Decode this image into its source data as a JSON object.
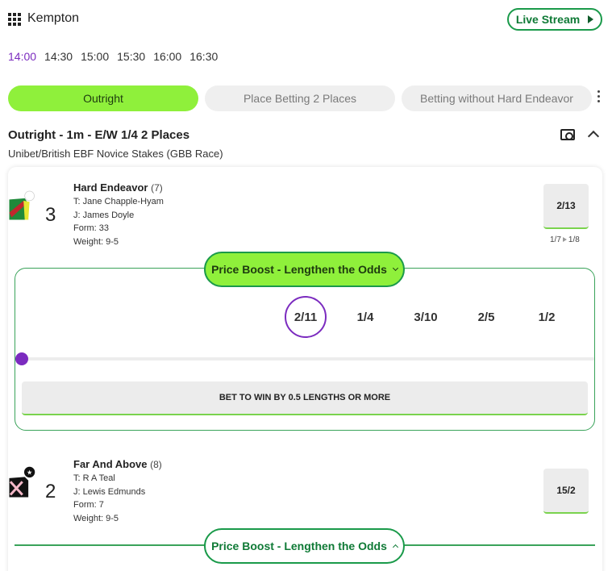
{
  "header": {
    "venue": "Kempton",
    "live_stream_label": "Live Stream"
  },
  "race_times": [
    {
      "label": "14:00",
      "active": true
    },
    {
      "label": "14:30",
      "active": false
    },
    {
      "label": "15:00",
      "active": false
    },
    {
      "label": "15:30",
      "active": false
    },
    {
      "label": "16:00",
      "active": false
    },
    {
      "label": "16:30",
      "active": false
    }
  ],
  "bet_tabs": [
    {
      "label": "Outright",
      "active": true
    },
    {
      "label": "Place Betting 2 Places",
      "active": false
    },
    {
      "label": "Betting without Hard Endeavor",
      "active": false
    }
  ],
  "market": {
    "title": "Outright - 1m - E/W 1/4 2 Places",
    "subtitle": "Unibet/British EBF Novice Stakes (GBB Race)"
  },
  "runners": [
    {
      "name": "Hard Endeavor",
      "draw": "(7)",
      "saddle": "3",
      "trainer": "T: Jane Chapple-Hyam",
      "jockey": "J: James Doyle",
      "form": "Form: 33",
      "weight": "Weight: 9-5",
      "odds": "2/13",
      "price_from": "1/7",
      "price_to": "1/8",
      "silk_colors": {
        "body": "#1f8a3a",
        "band": "#c0272d",
        "sleeve": "#e6e633",
        "cap": "#ffffff"
      }
    },
    {
      "name": "Far And Above",
      "draw": "(8)",
      "saddle": "2",
      "trainer": "T: R A Teal",
      "jockey": "J: Lewis Edmunds",
      "form": "Form: 7",
      "weight": "Weight: 9-5",
      "odds": "15/2",
      "silk_colors": {
        "body": "#111111",
        "cross": "#f4b8c8",
        "cap": "#111111"
      }
    }
  ],
  "price_boost": {
    "label": "Price Boost - Lengthen the Odds",
    "options": [
      "2/11",
      "1/4",
      "3/10",
      "2/5",
      "1/2"
    ],
    "selected_index": 0,
    "bet_label": "BET TO WIN BY 0.5 LENGTHS OR MORE"
  },
  "colors": {
    "accent_green": "#8ff03b",
    "brand_green": "#1a9a4a",
    "purple": "#7b2bbf"
  }
}
